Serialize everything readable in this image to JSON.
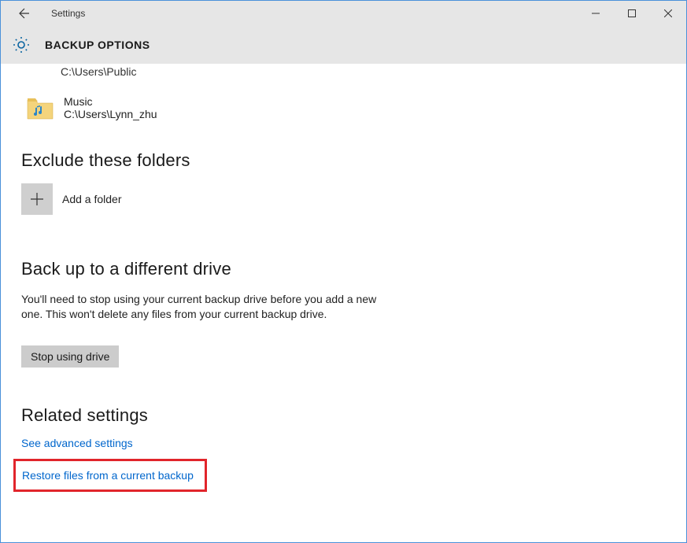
{
  "titlebar": {
    "title": "Settings"
  },
  "header": {
    "heading": "BACKUP OPTIONS"
  },
  "truncated_folder": {
    "path_fragment": "C:\\Users\\Public"
  },
  "folder": {
    "name": "Music",
    "path": "C:\\Users\\Lynn_zhu"
  },
  "sections": {
    "exclude": {
      "title": "Exclude these folders",
      "add_label": "Add a folder"
    },
    "different_drive": {
      "title": "Back up to a different drive",
      "description": "You'll need to stop using your current backup drive before you add a new one. This won't delete any files from your current backup drive.",
      "button": "Stop using drive"
    },
    "related": {
      "title": "Related settings",
      "link_advanced": "See advanced settings",
      "link_restore": "Restore files from a current backup"
    }
  }
}
